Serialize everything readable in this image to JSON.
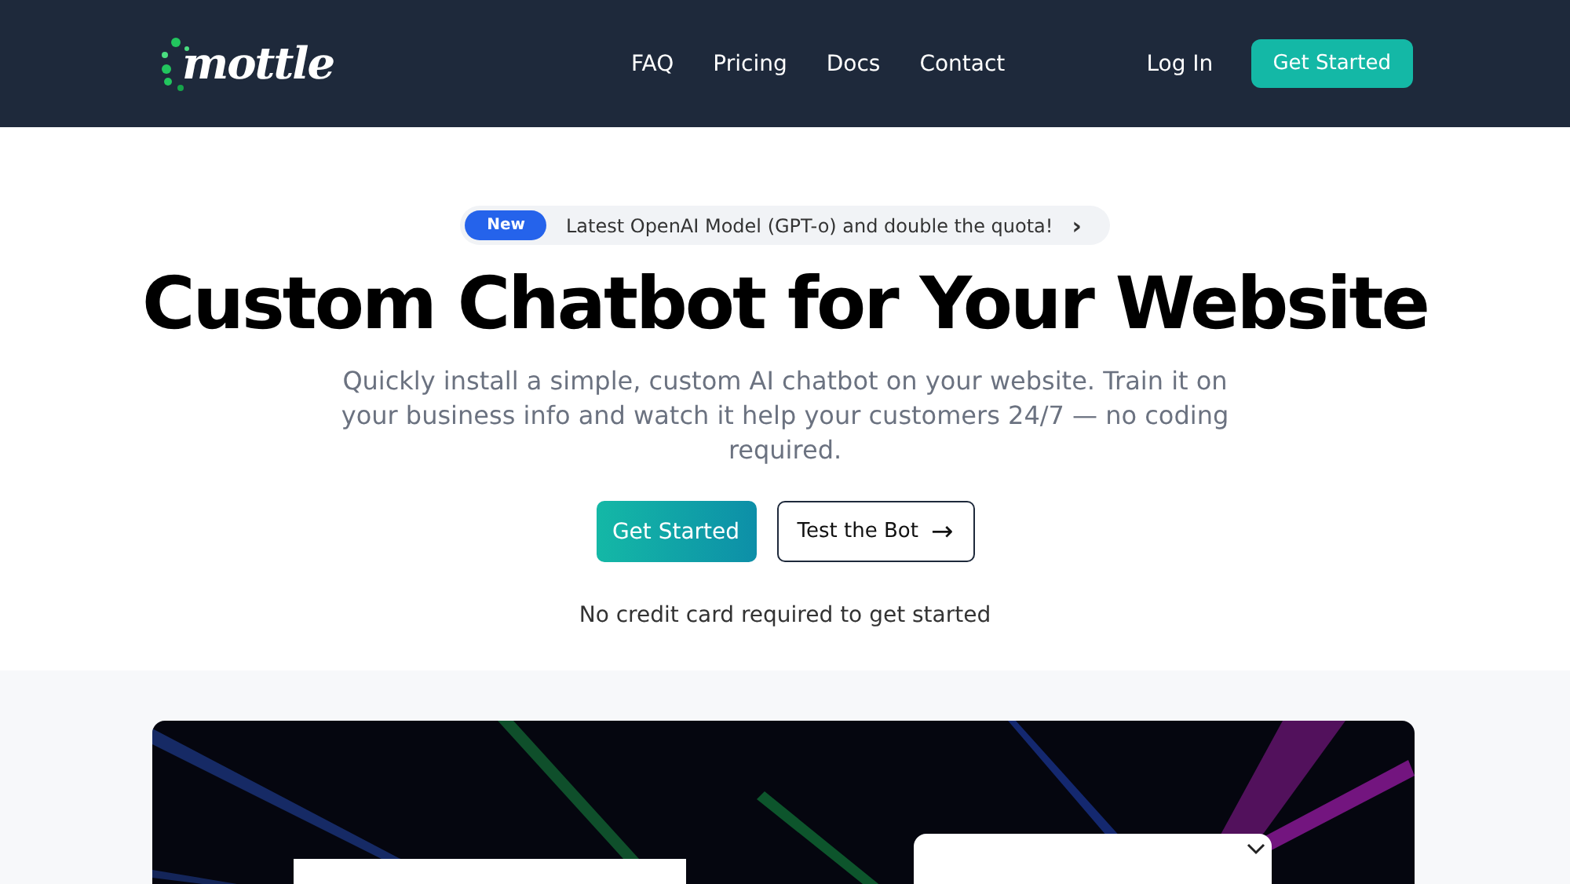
{
  "header": {
    "logo": "mottle",
    "nav": [
      "FAQ",
      "Pricing",
      "Docs",
      "Contact"
    ],
    "login": "Log In",
    "cta": "Get Started"
  },
  "announcement": {
    "badge": "New",
    "text": "Latest OpenAI Model (GPT-o) and double the quota!",
    "arrow": "›"
  },
  "hero": {
    "title": "Custom Chatbot for Your Website",
    "subtitle": "Quickly install a simple, custom AI chatbot on your website. Train it on your business info and watch it help your customers 24/7 — no coding required.",
    "primary": "Get Started",
    "secondary": "Test the Bot",
    "secondary_arrow": "→",
    "note": "No credit card required to get started"
  }
}
